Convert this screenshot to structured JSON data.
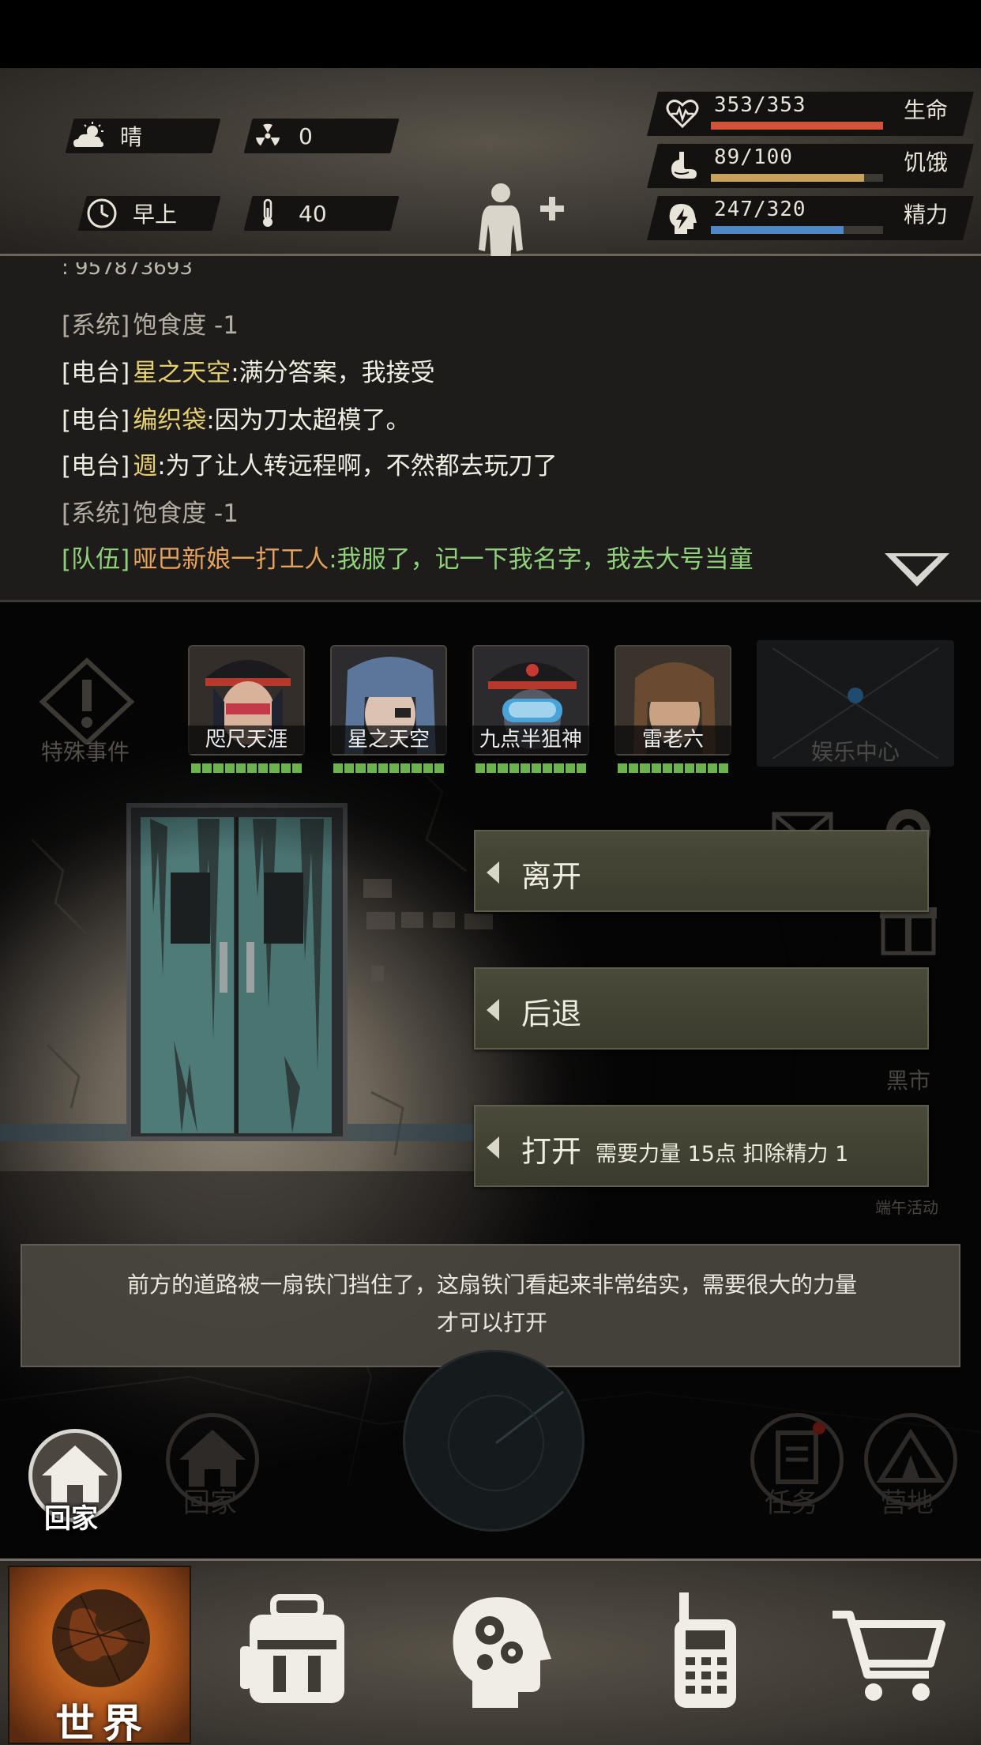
{
  "status": {
    "weather": "晴",
    "radiation": "0",
    "time_of_day": "早上",
    "temperature": "40",
    "vitals": [
      {
        "icon": "heart-icon",
        "value": "353/353",
        "label": "生命",
        "fraction": 1.0,
        "color": "#d0533a"
      },
      {
        "icon": "stomach-icon",
        "value": "89/100",
        "label": "饥饿",
        "fraction": 0.89,
        "color": "#c7a25c"
      },
      {
        "icon": "energy-icon",
        "value": "247/320",
        "label": "精力",
        "fraction": 0.77,
        "color": "#4f88c9"
      }
    ]
  },
  "chat": {
    "cut_line": ": 957873693",
    "lines": [
      {
        "tag": "[系统]",
        "tag_color": "#b3ada2",
        "name": "",
        "name_color": "#b3ada2",
        "text": "饱食度 -1",
        "text_color": "#b3ada2"
      },
      {
        "tag": "[电台]",
        "tag_color": "#f0ede2",
        "name": "星之天空",
        "name_color": "#e6cf6f",
        "text": ":满分答案，我接受",
        "text_color": "#f0ede2"
      },
      {
        "tag": "[电台]",
        "tag_color": "#f0ede2",
        "name": "编织袋",
        "name_color": "#e6cf6f",
        "text": ":因为刀太超模了。",
        "text_color": "#f0ede2"
      },
      {
        "tag": "[电台]",
        "tag_color": "#f0ede2",
        "name": "週",
        "name_color": "#e6cf6f",
        "text": ":为了让人转远程啊，不然都去玩刀了",
        "text_color": "#f0ede2"
      },
      {
        "tag": "[系统]",
        "tag_color": "#b3ada2",
        "name": "",
        "name_color": "#b3ada2",
        "text": "饱食度 -1",
        "text_color": "#b3ada2"
      },
      {
        "tag": "[队伍]",
        "tag_color": "#8fd17a",
        "name": "哑巴新娘一打工人",
        "name_color": "#e5a25a",
        "text": ":我服了，记一下我名字，我去大号当童",
        "text_color": "#8fd17a"
      }
    ]
  },
  "scene": {
    "special_events": "特殊事件",
    "entertainment": "娱乐中心",
    "black_market": "黑市",
    "festival": "端午活动",
    "teammates": [
      {
        "name": "咫尺天涯"
      },
      {
        "name": "星之天空"
      },
      {
        "name": "九点半狙神"
      },
      {
        "name": "雷老六"
      }
    ],
    "actions": [
      {
        "label": "离开",
        "requirement": ""
      },
      {
        "label": "后退",
        "requirement": ""
      },
      {
        "label": "打开",
        "requirement": "需要力量 15点 扣除精力 1"
      }
    ],
    "description_line1": "前方的道路被一扇铁门挡住了，这扇铁门看起来非常结实，需要很大的力量",
    "description_line2": "才可以打开",
    "home_active": "回家",
    "home_ghost": "回家",
    "tasks": "任务",
    "camp": "营地"
  },
  "nav": {
    "world": "世界",
    "items": [
      "backpack-icon",
      "skills-head-icon",
      "radio-icon",
      "shop-cart-icon"
    ]
  }
}
